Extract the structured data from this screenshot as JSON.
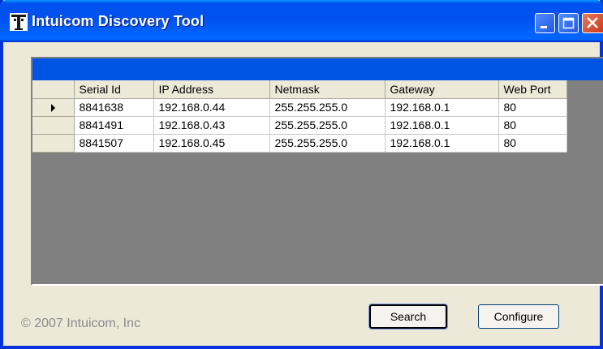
{
  "window": {
    "title": "Intuicom Discovery Tool",
    "icon": "intuicom-tower-icon",
    "controls": [
      "minimize-icon",
      "maximize-icon",
      "close-icon"
    ]
  },
  "grid": {
    "columns": [
      "Serial Id",
      "IP Address",
      "Netmask",
      "Gateway",
      "Web Port"
    ],
    "rows": [
      {
        "selected": true,
        "cells": [
          "8841638",
          "192.168.0.44",
          "255.255.255.0",
          "192.168.0.1",
          "80"
        ]
      },
      {
        "selected": false,
        "cells": [
          "8841491",
          "192.168.0.43",
          "255.255.255.0",
          "192.168.0.1",
          "80"
        ]
      },
      {
        "selected": false,
        "cells": [
          "8841507",
          "192.168.0.45",
          "255.255.255.0",
          "192.168.0.1",
          "80"
        ]
      }
    ],
    "caption_color": "#0054e3"
  },
  "footer": {
    "copyright": "© 2007 Intuicom, Inc"
  },
  "buttons": {
    "search": "Search",
    "configure": "Configure"
  },
  "colors": {
    "titlebar": "#0054e3",
    "close_button": "#c93a18",
    "window_face": "#ece9d8",
    "grid_empty": "#808080"
  }
}
